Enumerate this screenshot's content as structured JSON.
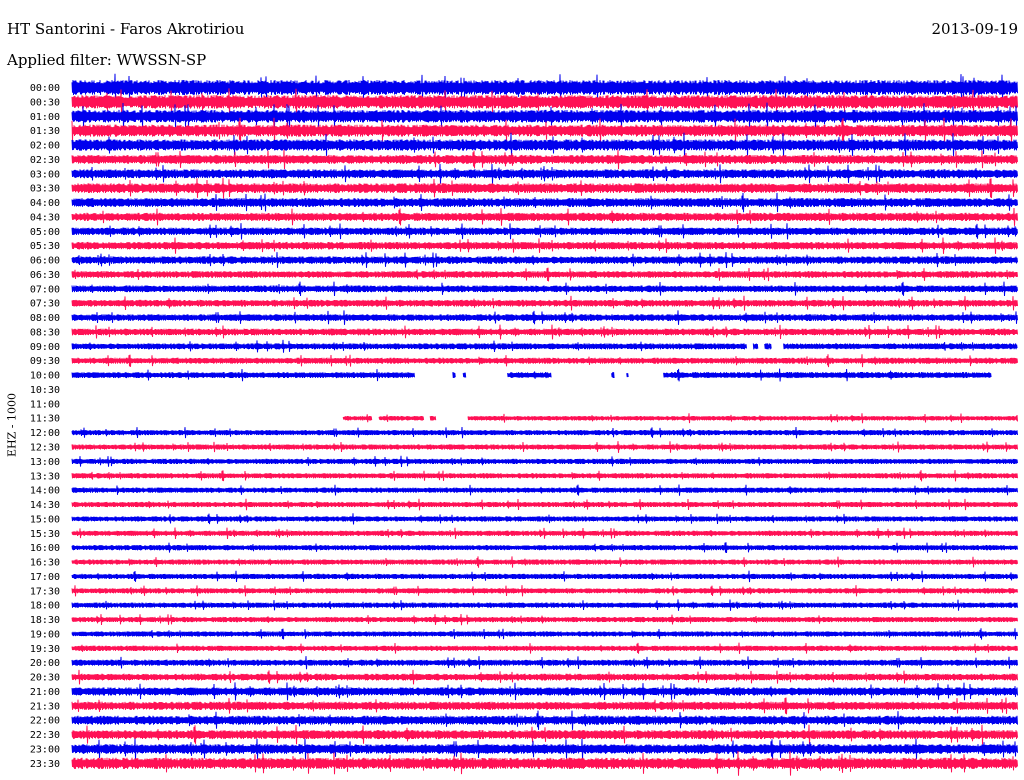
{
  "header": {
    "station": "HT Santorini - Faros Akrotiriou",
    "date": "2013-09-19",
    "filter": "Applied filter: WWSSN-SP"
  },
  "chart_data": {
    "type": "line",
    "title": "HT Santorini - Faros Akrotiriou",
    "channel_label": "EHZ - 1000",
    "xlabel": "",
    "ylabel": "EHZ - 1000",
    "row_labels": [
      "00:00",
      "00:30",
      "01:00",
      "01:30",
      "02:00",
      "02:30",
      "03:00",
      "03:30",
      "04:00",
      "04:30",
      "05:00",
      "05:30",
      "06:00",
      "06:30",
      "07:00",
      "07:30",
      "08:00",
      "08:30",
      "09:00",
      "09:30",
      "10:00",
      "10:30",
      "11:00",
      "11:30",
      "12:00",
      "12:30",
      "13:00",
      "13:30",
      "14:00",
      "14:30",
      "15:00",
      "15:30",
      "16:00",
      "16:30",
      "17:00",
      "17:30",
      "18:00",
      "18:30",
      "19:00",
      "19:30",
      "20:00",
      "20:30",
      "21:00",
      "21:30",
      "22:00",
      "22:30",
      "23:00",
      "23:30"
    ],
    "colors": [
      "#0000ee",
      "#ff1155"
    ],
    "amplitude": [
      1.0,
      0.9,
      0.85,
      0.8,
      0.75,
      0.6,
      0.6,
      0.65,
      0.6,
      0.55,
      0.5,
      0.5,
      0.5,
      0.45,
      0.45,
      0.45,
      0.45,
      0.45,
      0.4,
      0.4,
      0.4,
      0,
      0,
      0.3,
      0.35,
      0.35,
      0.35,
      0.35,
      0.35,
      0.35,
      0.35,
      0.35,
      0.35,
      0.35,
      0.35,
      0.35,
      0.35,
      0.35,
      0.35,
      0.35,
      0.4,
      0.45,
      0.55,
      0.55,
      0.6,
      0.6,
      0.65,
      0.75
    ],
    "data_segments": [
      [
        [
          0,
          1
        ]
      ],
      [
        [
          0,
          1
        ]
      ],
      [
        [
          0,
          1
        ]
      ],
      [
        [
          0,
          1
        ]
      ],
      [
        [
          0,
          1
        ]
      ],
      [
        [
          0,
          1
        ]
      ],
      [
        [
          0,
          1
        ]
      ],
      [
        [
          0,
          1
        ]
      ],
      [
        [
          0,
          1
        ]
      ],
      [
        [
          0,
          1
        ]
      ],
      [
        [
          0,
          1
        ]
      ],
      [
        [
          0,
          1
        ]
      ],
      [
        [
          0,
          1
        ]
      ],
      [
        [
          0,
          1
        ]
      ],
      [
        [
          0,
          1
        ]
      ],
      [
        [
          0,
          1
        ]
      ],
      [
        [
          0,
          1
        ]
      ],
      [
        [
          0,
          1
        ]
      ],
      [
        [
          0,
          0.714
        ],
        [
          0.721,
          0.726
        ],
        [
          0.733,
          0.74
        ],
        [
          0.753,
          1
        ]
      ],
      [
        [
          0,
          1
        ]
      ],
      [
        [
          0,
          0.362
        ],
        [
          0.403,
          0.406
        ],
        [
          0.414,
          0.417
        ],
        [
          0.461,
          0.507
        ],
        [
          0.571,
          0.574
        ],
        [
          0.587,
          0.589
        ],
        [
          0.626,
          0.973
        ]
      ],
      [],
      [],
      [
        [
          0.287,
          0.317
        ],
        [
          0.325,
          0.372
        ],
        [
          0.379,
          0.385
        ],
        [
          0.419,
          1
        ]
      ],
      [
        [
          0,
          1
        ]
      ],
      [
        [
          0,
          1
        ]
      ],
      [
        [
          0,
          1
        ]
      ],
      [
        [
          0,
          1
        ]
      ],
      [
        [
          0,
          1
        ]
      ],
      [
        [
          0,
          1
        ]
      ],
      [
        [
          0,
          1
        ]
      ],
      [
        [
          0,
          1
        ]
      ],
      [
        [
          0,
          1
        ]
      ],
      [
        [
          0,
          1
        ]
      ],
      [
        [
          0,
          1
        ]
      ],
      [
        [
          0,
          1
        ]
      ],
      [
        [
          0,
          1
        ]
      ],
      [
        [
          0,
          1
        ]
      ],
      [
        [
          0,
          1
        ]
      ],
      [
        [
          0,
          1
        ]
      ],
      [
        [
          0,
          1
        ]
      ],
      [
        [
          0,
          1
        ]
      ],
      [
        [
          0,
          1
        ]
      ],
      [
        [
          0,
          1
        ]
      ],
      [
        [
          0,
          1
        ]
      ],
      [
        [
          0,
          1
        ]
      ],
      [
        [
          0,
          1
        ]
      ],
      [
        [
          0,
          1
        ]
      ]
    ],
    "grid": false
  }
}
